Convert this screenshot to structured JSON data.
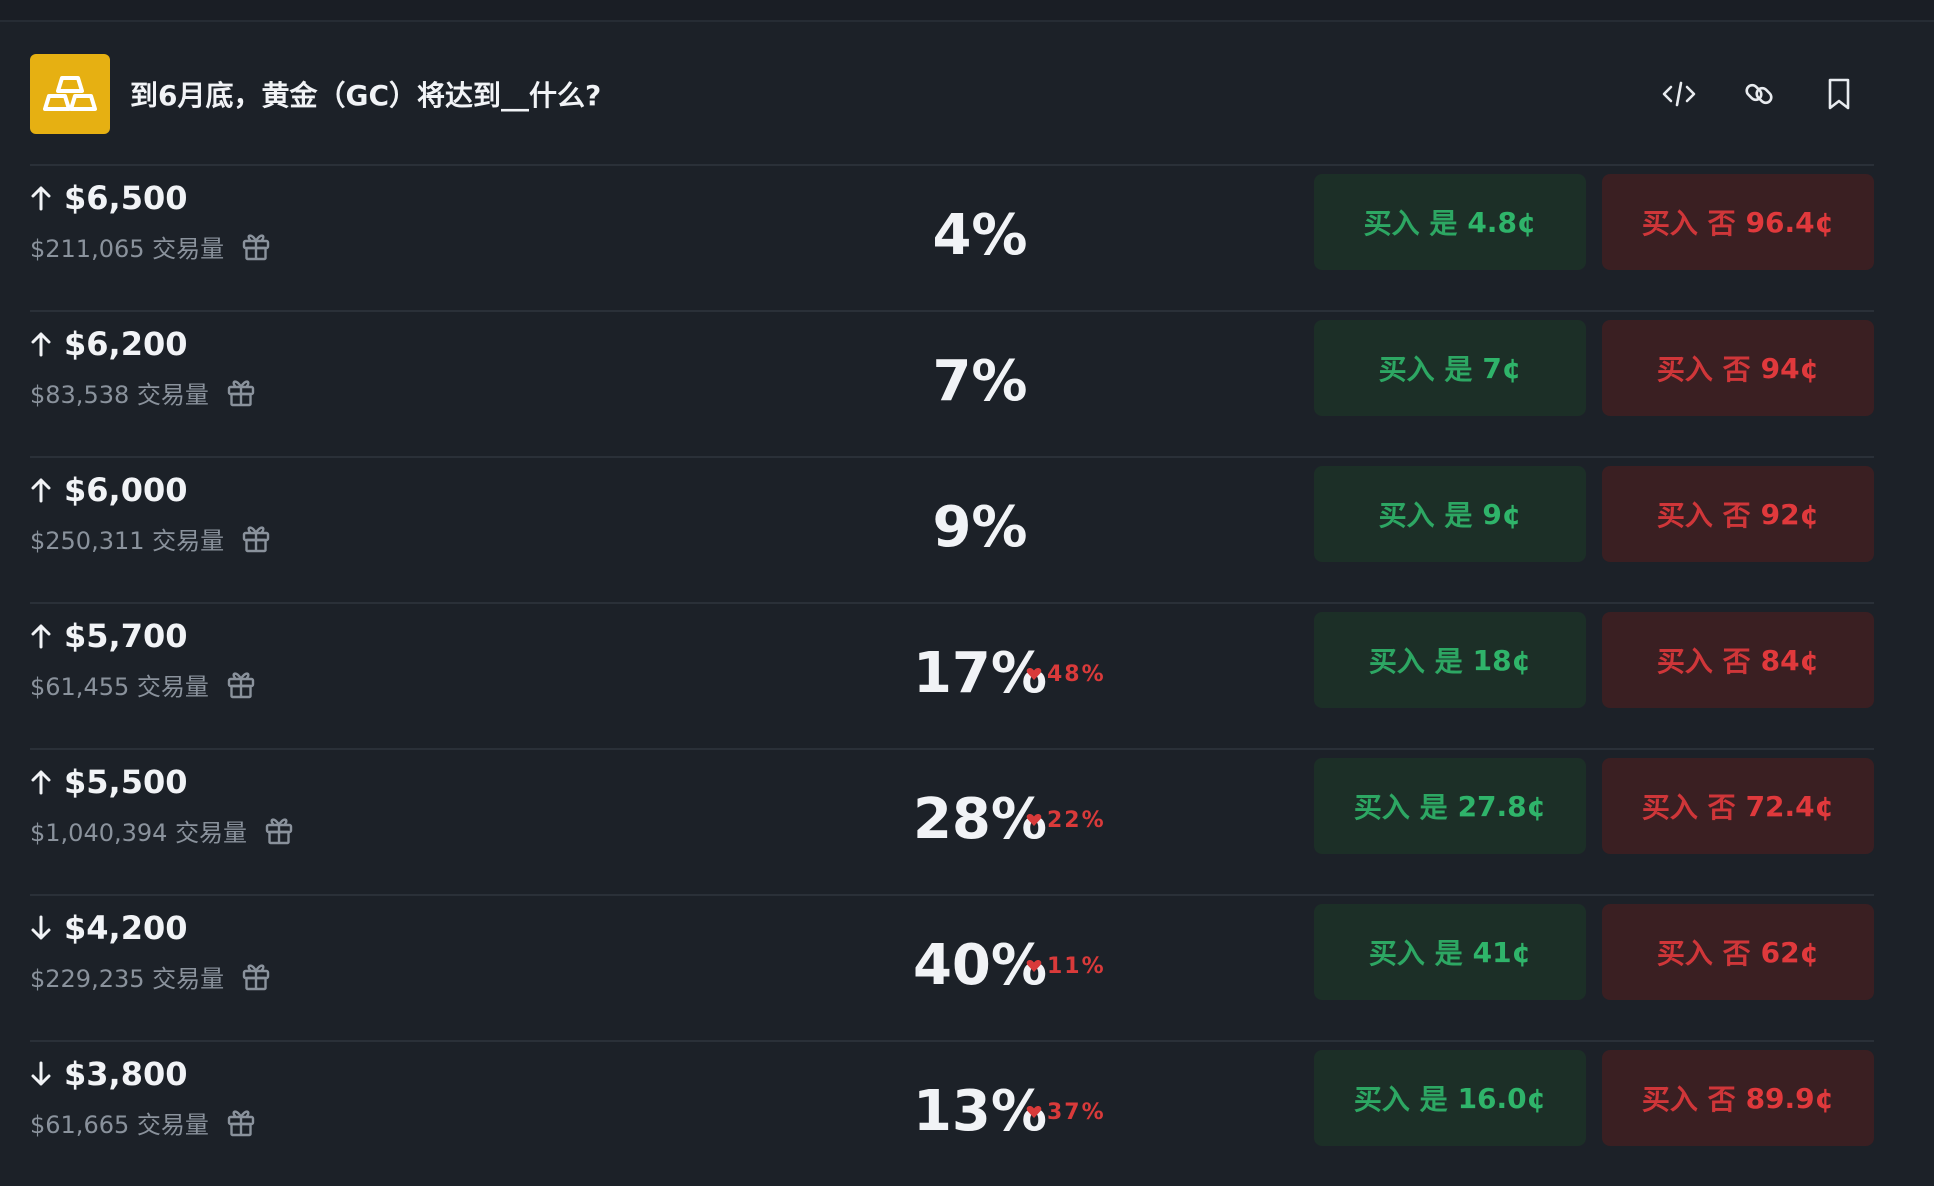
{
  "market": {
    "title": "到6月底，黄金（GC）将达到__什么?",
    "icon": "gold-bars-icon",
    "brand_color": "#e6b012"
  },
  "header_actions": [
    {
      "name": "embed-code-icon"
    },
    {
      "name": "link-icon"
    },
    {
      "name": "bookmark-icon"
    }
  ],
  "volume_suffix": "交易量",
  "labels": {
    "buy_yes": "买入 是",
    "buy_no": "买入 否"
  },
  "colors": {
    "yes": "#2fb46a",
    "no": "#e0393c",
    "delta_down": "#d93a3a"
  },
  "outcomes": [
    {
      "direction": "up",
      "strike": "$6,500",
      "volume": "$211,065",
      "prob": "4%",
      "delta": "",
      "yes_price": "4.8¢",
      "no_price": "96.4¢"
    },
    {
      "direction": "up",
      "strike": "$6,200",
      "volume": "$83,538",
      "prob": "7%",
      "delta": "",
      "yes_price": "7¢",
      "no_price": "94¢"
    },
    {
      "direction": "up",
      "strike": "$6,000",
      "volume": "$250,311",
      "prob": "9%",
      "delta": "",
      "yes_price": "9¢",
      "no_price": "92¢"
    },
    {
      "direction": "up",
      "strike": "$5,700",
      "volume": "$61,455",
      "prob": "17%",
      "delta": "48%",
      "yes_price": "18¢",
      "no_price": "84¢"
    },
    {
      "direction": "up",
      "strike": "$5,500",
      "volume": "$1,040,394",
      "prob": "28%",
      "delta": "22%",
      "yes_price": "27.8¢",
      "no_price": "72.4¢"
    },
    {
      "direction": "down",
      "strike": "$4,200",
      "volume": "$229,235",
      "prob": "40%",
      "delta": "11%",
      "yes_price": "41¢",
      "no_price": "62¢"
    },
    {
      "direction": "down",
      "strike": "$3,800",
      "volume": "$61,665",
      "prob": "13%",
      "delta": "37%",
      "yes_price": "16.0¢",
      "no_price": "89.9¢"
    }
  ]
}
